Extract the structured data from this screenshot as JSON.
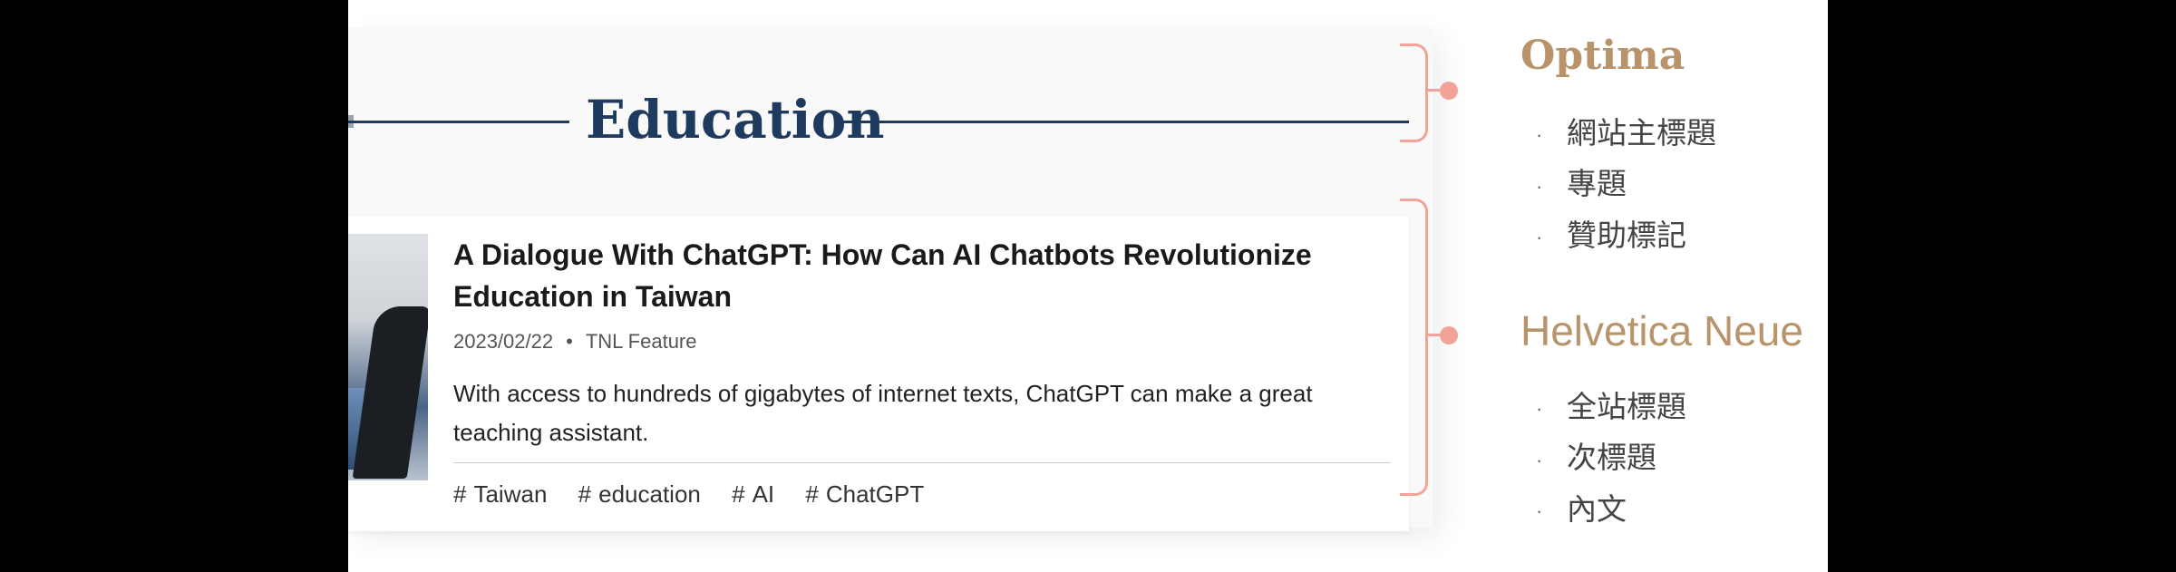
{
  "section": {
    "title": "Education"
  },
  "article": {
    "title": "A Dialogue With ChatGPT: How Can AI Chatbots Revolutionize Education in Taiwan",
    "date": "2023/02/22",
    "separator": "•",
    "author": "TNL Feature",
    "excerpt": "With access to hundreds of gigabytes of internet texts, ChatGPT can make a great teaching assistant.",
    "tags": [
      {
        "hash": "#",
        "label": "Taiwan"
      },
      {
        "hash": "#",
        "label": "education"
      },
      {
        "hash": "#",
        "label": "AI"
      },
      {
        "hash": "#",
        "label": "ChatGPT"
      }
    ]
  },
  "font_specs": [
    {
      "font_name": "Optima",
      "usages": [
        "網站主標題",
        "專題",
        "贊助標記"
      ]
    },
    {
      "font_name": "Helvetica Neue",
      "usages": [
        "全站標題",
        "次標題",
        "內文"
      ]
    }
  ],
  "bullet_glyph": "·",
  "colors": {
    "title_navy": "#1e3a5f",
    "annotation_salmon": "#f2a398",
    "font_label_gold": "#b8946b"
  }
}
